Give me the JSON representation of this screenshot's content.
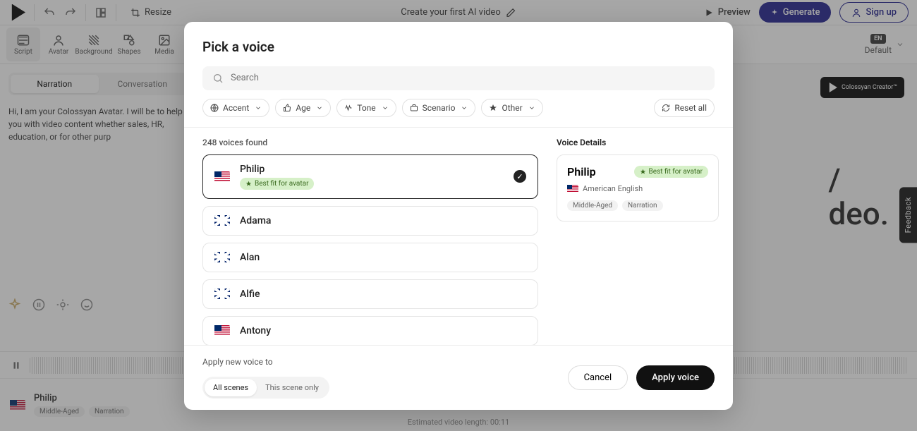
{
  "topbar": {
    "resize": "Resize",
    "title": "Create your first AI video",
    "preview": "Preview",
    "generate": "Generate",
    "signup": "Sign up"
  },
  "tools": {
    "items": [
      "Script",
      "Avatar",
      "Background",
      "Shapes",
      "Media"
    ],
    "lang_badge": "EN",
    "lang_text": "Default"
  },
  "script": {
    "tabs": {
      "narration": "Narration",
      "conversation": "Conversation"
    },
    "text": "Hi, I am your Colossyan Avatar. I will be to help you with video content whether sales, HR, education, or for other purp"
  },
  "canvas": {
    "logo_text": "Colossyan Creator™",
    "headline_l1": "/",
    "headline_l2": "deo."
  },
  "timeline": {
    "voice_name": "Philip",
    "tag1": "Middle-Aged",
    "tag2": "Narration",
    "est_prefix": "Estimated video length: ",
    "est_value": "00:11"
  },
  "modal": {
    "title": "Pick a voice",
    "search_placeholder": "Search",
    "filters": {
      "accent": "Accent",
      "age": "Age",
      "tone": "Tone",
      "scenario": "Scenario",
      "other": "Other"
    },
    "reset": "Reset all",
    "found": "248 voices found",
    "voices": [
      {
        "name": "Philip",
        "flag": "us",
        "bestfit": true,
        "selected": true
      },
      {
        "name": "Adama",
        "flag": "uk"
      },
      {
        "name": "Alan",
        "flag": "uk"
      },
      {
        "name": "Alfie",
        "flag": "uk"
      },
      {
        "name": "Antony",
        "flag": "us"
      }
    ],
    "bestfit_label": "Best fit for avatar",
    "details": {
      "label": "Voice Details",
      "name": "Philip",
      "bestfit": "Best fit for avatar",
      "language": "American English",
      "tag1": "Middle-Aged",
      "tag2": "Narration"
    },
    "footer": {
      "apply_to": "Apply new voice to",
      "all_scenes": "All scenes",
      "this_scene": "This scene only",
      "cancel": "Cancel",
      "apply": "Apply voice"
    }
  },
  "feedback": "Feedback"
}
